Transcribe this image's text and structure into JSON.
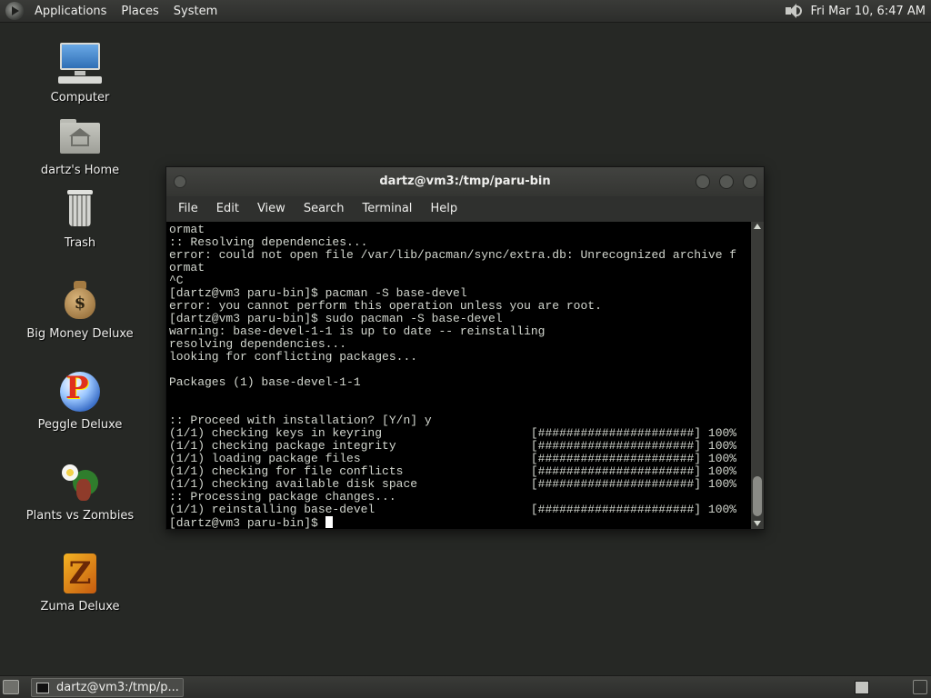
{
  "top_panel": {
    "menus": [
      "Applications",
      "Places",
      "System"
    ],
    "clock": "Fri Mar 10,  6:47 AM",
    "icons": {
      "logo": "main-menu-logo-icon",
      "volume": "volume-icon"
    }
  },
  "desktop": {
    "icons": [
      {
        "label": "Computer",
        "icon": "computer-icon"
      },
      {
        "label": "dartz's Home",
        "icon": "home-folder-icon"
      },
      {
        "label": "Trash",
        "icon": "trash-icon"
      },
      {
        "label": "Big Money Deluxe",
        "icon": "money-bag-icon",
        "glyph": "$"
      },
      {
        "label": "Peggle Deluxe",
        "icon": "peggle-icon",
        "glyph": "P"
      },
      {
        "label": "Plants vs Zombies",
        "icon": "plants-vs-zombies-icon"
      },
      {
        "label": "Zuma Deluxe",
        "icon": "zuma-icon",
        "glyph": "Z"
      }
    ]
  },
  "terminal": {
    "title": "dartz@vm3:/tmp/paru-bin",
    "menu": [
      "File",
      "Edit",
      "View",
      "Search",
      "Terminal",
      "Help"
    ],
    "lines": [
      "ormat",
      ":: Resolving dependencies...",
      "error: could not open file /var/lib/pacman/sync/extra.db: Unrecognized archive f",
      "ormat",
      "^C",
      "[dartz@vm3 paru-bin]$ pacman -S base-devel",
      "error: you cannot perform this operation unless you are root.",
      "[dartz@vm3 paru-bin]$ sudo pacman -S base-devel",
      "warning: base-devel-1-1 is up to date -- reinstalling",
      "resolving dependencies...",
      "looking for conflicting packages...",
      "",
      "Packages (1) base-devel-1-1",
      "",
      "",
      ":: Proceed with installation? [Y/n] y",
      "(1/1) checking keys in keyring                     [######################] 100%",
      "(1/1) checking package integrity                   [######################] 100%",
      "(1/1) loading package files                        [######################] 100%",
      "(1/1) checking for file conflicts                  [######################] 100%",
      "(1/1) checking available disk space                [######################] 100%",
      ":: Processing package changes...",
      "(1/1) reinstalling base-devel                      [######################] 100%"
    ],
    "prompt": "[dartz@vm3 paru-bin]$ "
  },
  "bottom_panel": {
    "task": "dartz@vm3:/tmp/p...",
    "icons": {
      "show_desktop": "show-desktop-icon",
      "task": "terminal-icon",
      "workspace": "workspace-switcher-icon"
    }
  },
  "colors": {
    "desktop_bg": "#262825",
    "panel_bg": "#343532",
    "terminal_bg": "#000000",
    "terminal_fg": "#d3d7cf"
  }
}
